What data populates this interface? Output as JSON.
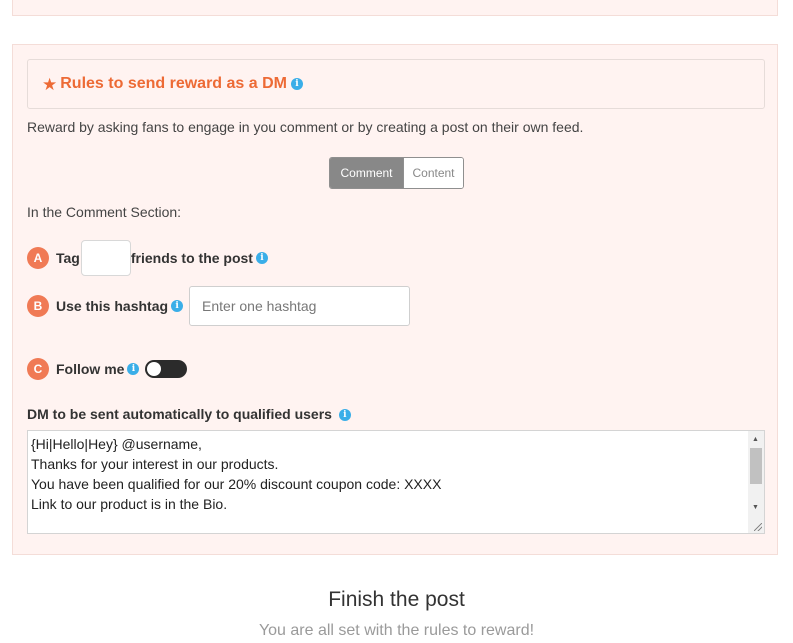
{
  "rules": {
    "title": "Rules to send reward as a DM",
    "description": "Reward by asking fans to engage in you comment or by creating a post on their own feed.",
    "tabs": [
      "Comment",
      "Content"
    ],
    "active_tab": "Comment"
  },
  "comment_section": {
    "heading": "In the Comment Section:",
    "a": {
      "badge": "A",
      "prefix": "Tag",
      "suffix": "friends to the post",
      "value": ""
    },
    "b": {
      "badge": "B",
      "label": "Use this hashtag",
      "placeholder": "Enter one hashtag",
      "value": ""
    },
    "c": {
      "badge": "C",
      "label": "Follow me",
      "toggle_on": false
    }
  },
  "dm": {
    "label": "DM to be sent automatically to qualified users",
    "message": "{Hi|Hello|Hey} @username,\nThanks for your interest in our products.\nYou have been qualified for our 20% discount coupon code: XXXX\nLink to our product is in the Bio."
  },
  "finish": {
    "title": "Finish the post",
    "subtitle": "You are all set with the rules to reward!"
  },
  "colors": {
    "accent": "#ed6a35",
    "badge": "#f07a55",
    "info": "#3aaee8",
    "panel_bg": "#fff3f1"
  },
  "icons": {
    "title_icon": "star-icon",
    "info_icon": "info-icon"
  }
}
